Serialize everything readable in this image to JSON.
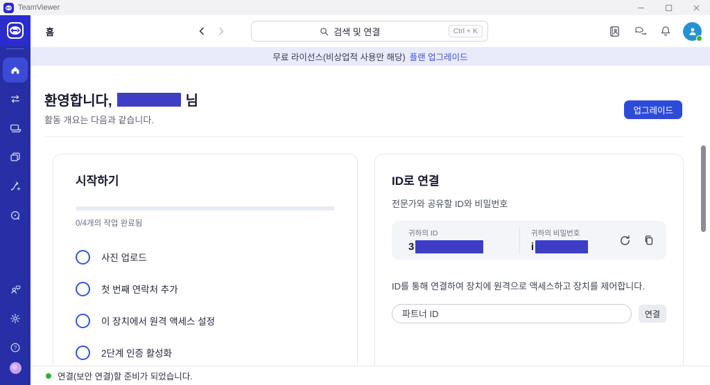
{
  "window": {
    "app_title": "TeamViewer"
  },
  "topbar": {
    "tab_home": "홈",
    "search_placeholder": "검색 및 연결",
    "search_shortcut": "Ctrl + K"
  },
  "banner": {
    "text": "무료 라이선스(비상업적 사용만 해당)",
    "link": "플랜 업그레이드"
  },
  "main": {
    "welcome_prefix": "환영합니다,",
    "welcome_suffix": "님",
    "subtitle": "활동 개요는 다음과 같습니다.",
    "upgrade_button": "업그레이드"
  },
  "getting_started": {
    "title": "시작하기",
    "progress_text": "0/4개의 작업 완료됨",
    "progress_percent": 0,
    "tasks": [
      {
        "label": "사진 업로드"
      },
      {
        "label": "첫 번째 연락처 추가"
      },
      {
        "label": "이 장치에서 원격 액세스 설정"
      },
      {
        "label": "2단계 인증 활성화"
      }
    ]
  },
  "connect_by_id": {
    "title": "ID로 연결",
    "subtitle": "전문가와 공유할 ID와 비밀번호",
    "id_label": "귀하의 ID",
    "id_value_visible": "3",
    "password_label": "귀하의 비밀번호",
    "password_value_visible": "i",
    "description": "ID를 통해 연결하여 장치에 원격으로 액세스하고 장치를 제어합니다.",
    "partner_id_placeholder": "파트너 ID",
    "connect_button": "연결"
  },
  "statusbar": {
    "text": "연결(보안 연결)할 준비가 되었습니다."
  },
  "icons": {
    "help_glyph": "?"
  },
  "colors": {
    "sidebar": "#262fa6",
    "logo_tile": "#2b2bcf",
    "active_item": "#3c4bd7",
    "accent_blue": "#2e4bd8",
    "redaction_blue": "#3d3ec5",
    "banner_bg": "#e9ebfb",
    "avatar_blue": "#2492d2",
    "status_green": "#2fae3f",
    "presence_purple": "#c9a0ef"
  }
}
